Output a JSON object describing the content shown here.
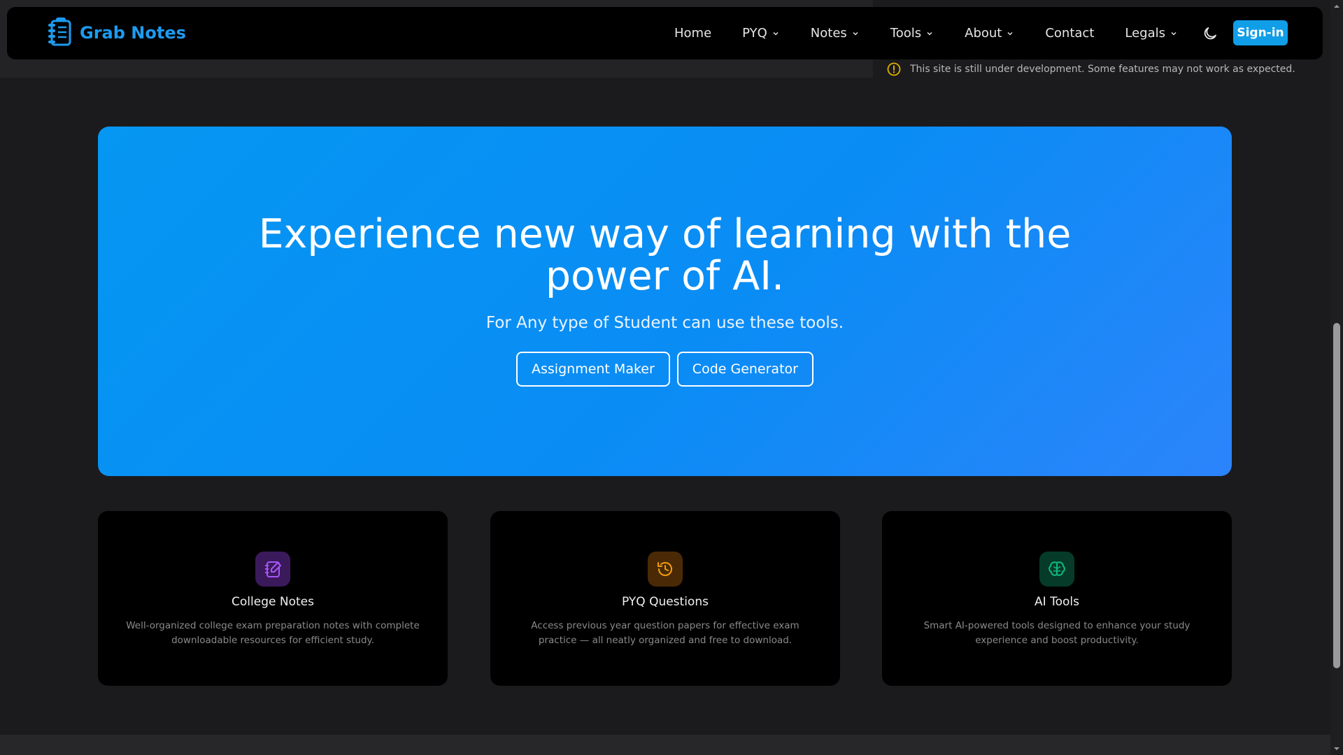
{
  "brand": {
    "name": "Grab Notes",
    "icon": "notebook-logo-icon"
  },
  "nav": [
    {
      "label": "Home",
      "dropdown": false
    },
    {
      "label": "PYQ",
      "dropdown": true
    },
    {
      "label": "Notes",
      "dropdown": true
    },
    {
      "label": "Tools",
      "dropdown": true
    },
    {
      "label": "About",
      "dropdown": true
    },
    {
      "label": "Contact",
      "dropdown": false
    },
    {
      "label": "Legals",
      "dropdown": true
    }
  ],
  "theme_toggle": {
    "icon": "moon-icon"
  },
  "signin": {
    "label": "Sign-in"
  },
  "notice": {
    "text": "This site is still under development. Some features may not work as expected.",
    "icon": "warning-circle-icon"
  },
  "hero": {
    "title": "Experience new way of learning with the power of AI.",
    "subtitle": "For Any type of Student can use these tools.",
    "buttons": [
      "Assignment Maker",
      "Code Generator"
    ]
  },
  "cards": [
    {
      "title": "College Notes",
      "description": "Well-organized college exam preparation notes with complete downloadable resources for efficient study.",
      "icon": "edit-notebook-icon",
      "color": "#a855f7"
    },
    {
      "title": "PYQ Questions",
      "description": "Access previous year question papers for effective exam practice — all neatly organized and free to download.",
      "icon": "history-clock-icon",
      "color": "#f59e0b"
    },
    {
      "title": "AI Tools",
      "description": "Smart AI-powered tools designed to enhance your study experience and boost productivity.",
      "icon": "brain-icon",
      "color": "#10b981"
    }
  ],
  "colors": {
    "accent": "#1d9bf0",
    "signin_bg": "#109ee8",
    "warning": "#e0b000",
    "hero_start": "#0597f2",
    "hero_end": "#2c84fb"
  }
}
